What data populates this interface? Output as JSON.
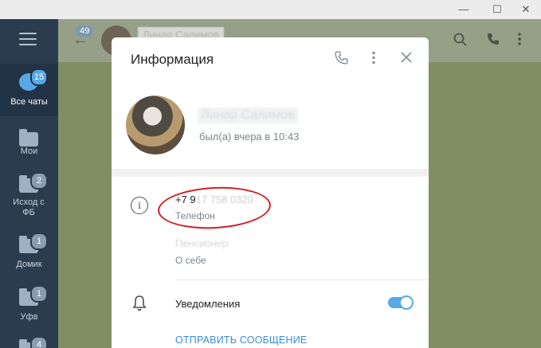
{
  "window": {
    "minimize": "—",
    "maximize": "☐",
    "close": "✕"
  },
  "sidebar": {
    "menu_icon": "hamburger-icon",
    "folders": [
      {
        "label": "Все чаты",
        "badge": "15",
        "active": true
      },
      {
        "label": "Мои",
        "badge": ""
      },
      {
        "label": "Исход с ФБ",
        "badge": "2"
      },
      {
        "label": "Домик",
        "badge": "1"
      },
      {
        "label": "Уфв",
        "badge": "1"
      },
      {
        "label": "",
        "badge": "4"
      }
    ]
  },
  "chat_header": {
    "unread_count": "49",
    "back_icon": "←",
    "title": "Линар Салимов",
    "icons": [
      "search-icon",
      "phone-icon",
      "more-vert-icon"
    ]
  },
  "modal": {
    "title": "Информация",
    "profile": {
      "name": "Линар Салимов",
      "status": "был(а) вчера в 10:43"
    },
    "phone": {
      "value_visible": "+7 9",
      "value_hidden": "17 758 0320",
      "label": "Телефон"
    },
    "bio": {
      "value": "Пенсионер",
      "label": "О себе"
    },
    "notifications": {
      "label": "Уведомления",
      "enabled": true
    },
    "send_message": "ОТПРАВИТЬ СООБЩЕНИЕ"
  },
  "colors": {
    "sidebar": "#2c3c4f",
    "accent": "#56a8e7",
    "annotation": "#d11f25",
    "chat_background": "#7f8f63"
  }
}
